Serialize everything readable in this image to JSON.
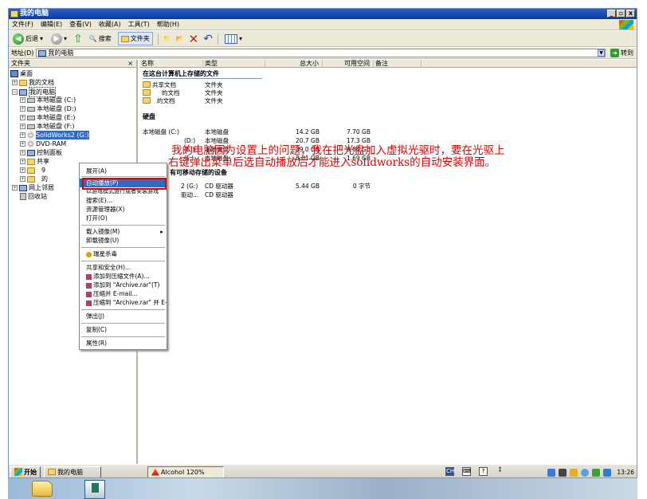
{
  "window": {
    "title": "我的电脑",
    "buttons": [
      "_",
      "▫",
      "x"
    ]
  },
  "menu": [
    "文件(F)",
    "编辑(E)",
    "查看(V)",
    "收藏(A)",
    "工具(T)",
    "帮助(H)"
  ],
  "toolbar": {
    "back": "后退",
    "search": "搜索",
    "folders": "文件夹"
  },
  "address": {
    "label": "地址(D)",
    "value": "我的电脑",
    "go": "转到"
  },
  "left_pane": {
    "header": "文件夹",
    "close": "×",
    "tree": [
      "桌面",
      "我的文档",
      "我的电脑",
      "本地磁盘 (C:)",
      "本地磁盘 (D:)",
      "本地磁盘 (E:)",
      "本地磁盘 (F:)",
      "SolidWorks2 (G:)",
      "DVD-RAM",
      "控制面板",
      "共享",
      "9",
      "的",
      "网上邻居",
      "回收站"
    ]
  },
  "columns": [
    "名称",
    "类型",
    "总大小",
    "可用空间",
    "备注"
  ],
  "groups": {
    "files": "在这台计算机上存储的文件",
    "disks": "硬盘",
    "removable": "有可移动存储的设备"
  },
  "files": [
    {
      "name": "共享文档",
      "type": "文件夹"
    },
    {
      "name": "的文档",
      "type": "文件夹"
    },
    {
      "name": "的文档",
      "type": "文件夹"
    }
  ],
  "disks": [
    {
      "name": "本地磁盘 (C:)",
      "type": "本地磁盘",
      "total": "14.2 GB",
      "free": "7.70 GB"
    },
    {
      "name": "(D:)",
      "type": "本地磁盘",
      "total": "20.7 GB",
      "free": "17.3 GB"
    },
    {
      "name": "(E:)",
      "type": "本地磁盘",
      "total": "39.0 GB",
      "free": "9.84 GB"
    },
    {
      "name": "(F:)",
      "type": "本地磁盘",
      "total": "8.01 GB",
      "free": "1.69 GB"
    }
  ],
  "removable": [
    {
      "name": "2 (G:)",
      "type": "CD 驱动器",
      "total": "5.44 GB",
      "free": "0 字节"
    },
    {
      "name": "驱动...",
      "type": "CD 驱动器",
      "total": "",
      "free": ""
    }
  ],
  "annotation": {
    "line1": "我的电脑因为设置上的问题，我在把光盘加入虚拟光驱时，要在光驱上",
    "line2": "右键弹出菜单后选自动播放后才能进入solidworks的自动安装界面。"
  },
  "context_menu": [
    "展开(A)",
    "自动播放(P)",
    "以游戏模式运行或者安装游戏",
    "搜索(E)...",
    "资源管理器(X)",
    "打开(O)",
    "载入镜像(M)",
    "卸载镜像(U)",
    "瑞星杀毒",
    "共享和安全(H)...",
    "添加到压缩文件(A)...",
    "添加到 \"Archive.rar\"(T)",
    "压缩并 E-mail...",
    "压缩到 \"Archive.rar\" 并 E-mail",
    "弹出(J)",
    "复制(C)",
    "属性(R)"
  ],
  "taskbar": {
    "start": "开始",
    "item1": "我的电脑",
    "item2": "Alcohol 120%",
    "clock": "13:26"
  },
  "colors": {
    "accent": "#316ac5",
    "annotation": "#e00000",
    "highlight_box": "#e00000"
  }
}
